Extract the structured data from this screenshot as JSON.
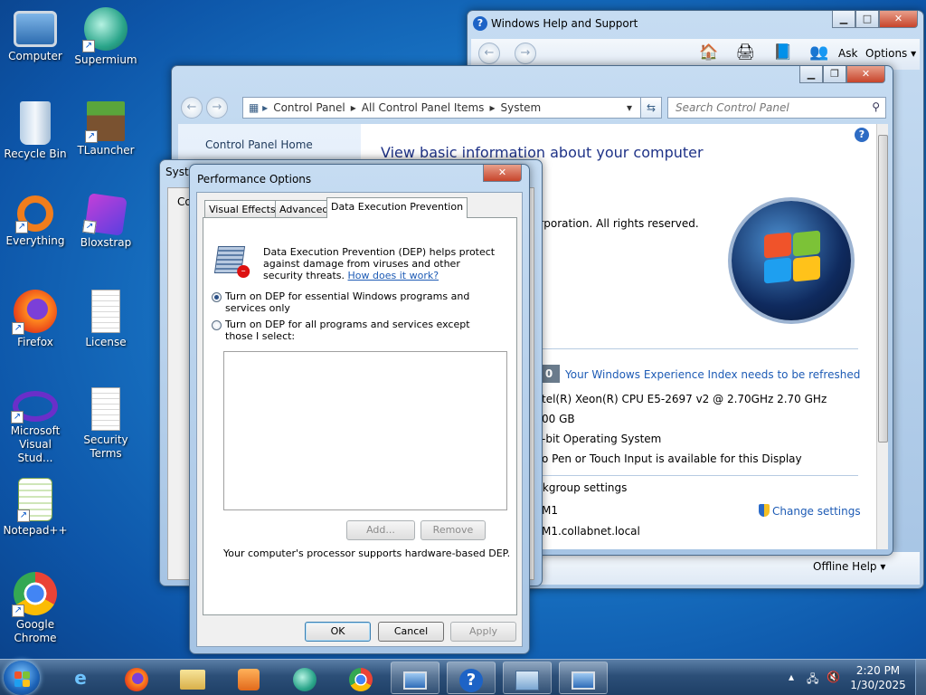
{
  "desktop": {
    "icons": [
      {
        "label": "Computer"
      },
      {
        "label": "Supermium"
      },
      {
        "label": "Recycle Bin"
      },
      {
        "label": "TLauncher"
      },
      {
        "label": "Everything"
      },
      {
        "label": "Bloxstrap"
      },
      {
        "label": "Firefox"
      },
      {
        "label": "License"
      },
      {
        "label": "Microsoft Visual Stud..."
      },
      {
        "label": "Security Terms"
      },
      {
        "label": "Notepad++"
      },
      {
        "label": "Google Chrome"
      }
    ]
  },
  "help_window": {
    "title": "Windows Help and Support",
    "ask": "Ask",
    "options": "Options ▾",
    "offline_help": "Offline Help ▾"
  },
  "control_panel": {
    "breadcrumb": [
      "Control Panel",
      "All Control Panel Items",
      "System"
    ],
    "search_placeholder": "Search Control Panel",
    "nav_home": "Control Panel Home",
    "heading": "View basic information about your computer",
    "copyright": "orporation.  All rights reserved.",
    "wei_score": "0",
    "wei_link": "Your Windows Experience Index needs to be refreshed",
    "processor": "tel(R) Xeon(R) CPU E5-2697 v2 @ 2.70GHz   2.70 GHz",
    "memory": "00 GB",
    "system_type": "-bit Operating System",
    "pen_touch": "o Pen or Touch Input is available for this Display",
    "workgroup_header": "rkgroup settings",
    "computer_name": "M1",
    "full_name": "M1.collabnet.local",
    "change_settings": "Change settings"
  },
  "system_properties": {
    "title": "Syste",
    "tab_fragment": "Co"
  },
  "perf_dialog": {
    "title": "Performance Options",
    "tabs": [
      "Visual Effects",
      "Advanced",
      "Data Execution Prevention"
    ],
    "description": "Data Execution Prevention (DEP) helps protect against damage from viruses and other security threats.",
    "how_link": "How does it work?",
    "option1": "Turn on DEP for essential Windows programs and services only",
    "option2": "Turn on DEP for all programs and services except those I select:",
    "add": "Add...",
    "remove": "Remove",
    "note": "Your computer's processor supports hardware-based DEP.",
    "ok": "OK",
    "cancel": "Cancel",
    "apply": "Apply"
  },
  "taskbar": {
    "time": "2:20 PM",
    "date": "1/30/2025"
  }
}
